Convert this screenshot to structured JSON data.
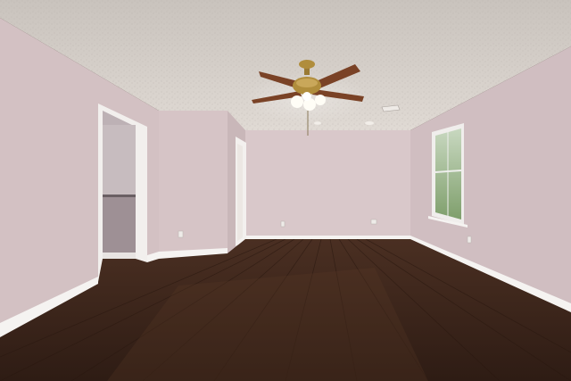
{
  "scene": {
    "colors": {
      "ceiling": "#d8d2cc",
      "wall_left": "#d3c2c4",
      "wall_back": "#d9c9cb",
      "wall_right": "#d0bec1",
      "floor": "#3a241a",
      "floor_light": "#5a3a28",
      "trim": "#f4f2f0",
      "fan_blade": "#7a4226",
      "fan_brass": "#b08d3c",
      "window_glass": "#9fb892"
    },
    "objects": [
      "textured-ceiling",
      "ceiling-fan",
      "closet-doorway",
      "hallway-doorway",
      "window",
      "hardwood-floor",
      "baseboards",
      "outlets",
      "air-vent"
    ]
  }
}
